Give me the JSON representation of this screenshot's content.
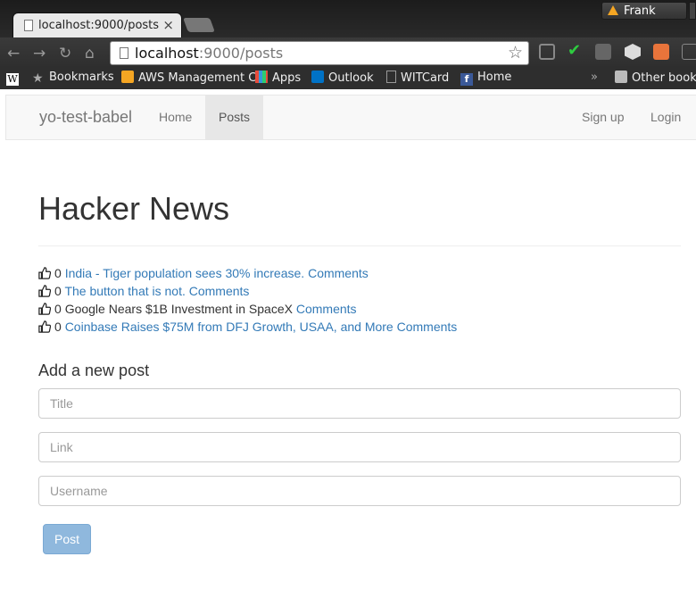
{
  "browser": {
    "tab_title": "localhost:9000/posts",
    "profile_name": "Frank",
    "url_host": "localhost",
    "url_path": ":9000/posts",
    "bookmarks": [
      {
        "label": "",
        "icon": "wikipedia-icon"
      },
      {
        "label": "Bookmarks",
        "icon": "star-icon"
      },
      {
        "label": "AWS Management C",
        "icon": "aws-icon"
      },
      {
        "label": "Apps",
        "icon": "apps-grid-icon"
      },
      {
        "label": "Outlook",
        "icon": "mail-icon"
      },
      {
        "label": "WITCard",
        "icon": "page-icon"
      },
      {
        "label": "Home",
        "icon": "facebook-icon"
      }
    ],
    "bookmarks_more": "»",
    "other_bookmarks": "Other bookm",
    "colors": {
      "aws": "#f5a623",
      "outlook": "#0072c6",
      "facebook": "#3b5998",
      "warning": "#f5a623"
    }
  },
  "navbar": {
    "brand": "yo-test-babel",
    "links": [
      {
        "label": "Home",
        "active": false
      },
      {
        "label": "Posts",
        "active": true
      }
    ],
    "right_links": [
      {
        "label": "Sign up"
      },
      {
        "label": "Login"
      }
    ]
  },
  "page": {
    "heading": "Hacker News",
    "posts": [
      {
        "votes": "0",
        "title": "India - Tiger population sees 30% increase.",
        "title_is_link": true,
        "comments": "Comments"
      },
      {
        "votes": "0",
        "title": "The button that is not.",
        "title_is_link": true,
        "comments": "Comments"
      },
      {
        "votes": "0",
        "title": "Google Nears $1B Investment in SpaceX",
        "title_is_link": false,
        "comments": "Comments"
      },
      {
        "votes": "0",
        "title": "Coinbase Raises $75M from DFJ Growth, USAA, and More",
        "title_is_link": true,
        "comments": "Comments"
      }
    ],
    "form": {
      "heading": "Add a new post",
      "title_placeholder": "Title",
      "link_placeholder": "Link",
      "username_placeholder": "Username",
      "submit_label": "Post"
    },
    "colors": {
      "link": "#337ab7",
      "button_disabled": "#8fb8dd"
    }
  }
}
